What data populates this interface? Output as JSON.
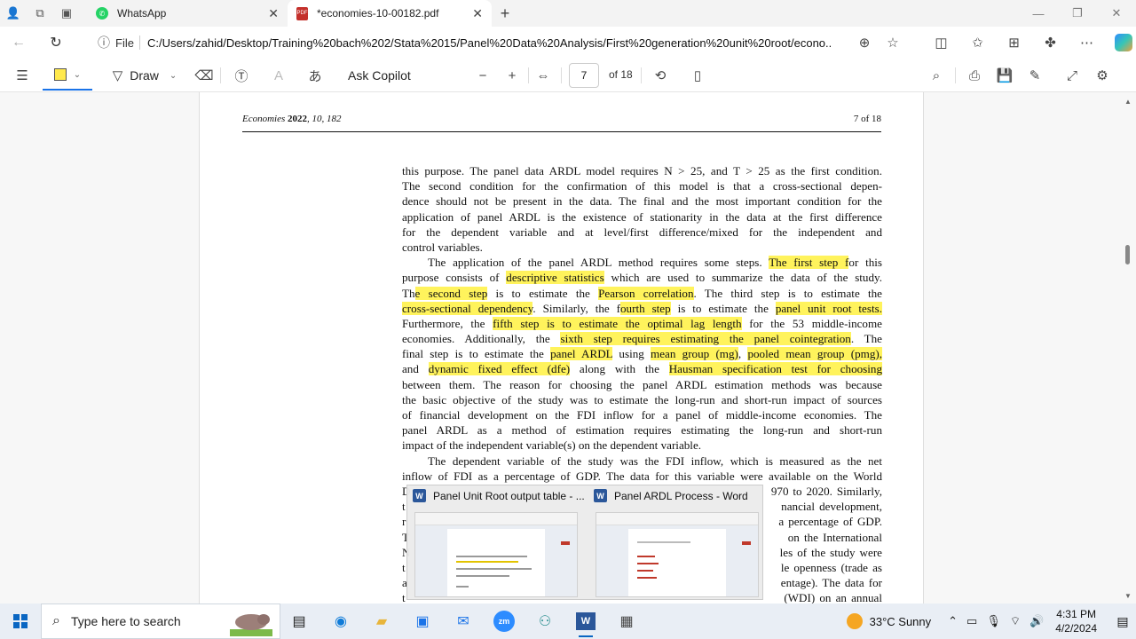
{
  "browser": {
    "tabs": [
      {
        "label": "WhatsApp",
        "close": "✕"
      },
      {
        "label": "*economies-10-00182.pdf",
        "close": "✕"
      }
    ],
    "new_tab": "+",
    "window_controls": [
      "—",
      "❐",
      "✕"
    ],
    "address": {
      "info_label": "File",
      "url": "C:/Users/zahid/Desktop/Training%20bach%202/Stata%2015/Panel%20Data%20Analysis/First%20generation%20unit%20root/econo..."
    }
  },
  "pdf_toolbar": {
    "draw_label": "Draw",
    "copilot_label": "Ask Copilot",
    "page_current": "7",
    "page_total": "of 18"
  },
  "document": {
    "running_head_journal": "Economies",
    "running_head_year": "2022",
    "running_head_vol": ", 10, 182",
    "running_head_page": "7 of 18",
    "lines": [
      {
        "segments": [
          {
            "t": "this purpose. The panel data ARDL model requires N > 25, and T > 25 as the first condition."
          }
        ]
      },
      {
        "segments": [
          {
            "t": "The second condition for the confirmation of this model is that a cross-sectional depen-"
          }
        ]
      },
      {
        "segments": [
          {
            "t": "dence should not be present in the data. The final and the most important condition for the"
          }
        ]
      },
      {
        "segments": [
          {
            "t": "application of panel ARDL is the existence of stationarity in the data at the first difference"
          }
        ]
      },
      {
        "segments": [
          {
            "t": "for the dependent variable and at level/first difference/mixed for the independent and"
          }
        ]
      },
      {
        "last": true,
        "segments": [
          {
            "t": "control variables."
          }
        ]
      },
      {
        "indent": true,
        "segments": [
          {
            "t": "The application of the panel ARDL method requires some steps. "
          },
          {
            "t": "The first step f",
            "hl": true
          },
          {
            "t": "or this"
          }
        ]
      },
      {
        "segments": [
          {
            "t": "purpose consists of "
          },
          {
            "t": "descriptive statistics",
            "hl": true
          },
          {
            "t": " which are used to summarize the data of the study."
          }
        ]
      },
      {
        "segments": [
          {
            "t": "Th"
          },
          {
            "t": "e second step",
            "hl": true
          },
          {
            "t": " is to estimate the "
          },
          {
            "t": "Pearson correlation",
            "hl": true
          },
          {
            "t": ". The third step is to estimate the"
          }
        ]
      },
      {
        "segments": [
          {
            "t": "cross-sectional dependency",
            "hl": true
          },
          {
            "t": ". Similarly, the f"
          },
          {
            "t": "ourth step",
            "hl": true
          },
          {
            "t": " is to estimate the "
          },
          {
            "t": "panel unit root tests.",
            "hl": true
          }
        ]
      },
      {
        "segments": [
          {
            "t": "Furthermore, the "
          },
          {
            "t": "fifth step is to estimate the optimal lag length",
            "hl": true
          },
          {
            "t": " for the 53 middle-income"
          }
        ]
      },
      {
        "segments": [
          {
            "t": "economies. Additionally, the "
          },
          {
            "t": "sixth step requires estimating the panel cointegration",
            "hl": true
          },
          {
            "t": ". The"
          }
        ]
      },
      {
        "segments": [
          {
            "t": "final step is to estimate the "
          },
          {
            "t": "panel ARDL",
            "hl": true
          },
          {
            "t": " using "
          },
          {
            "t": "mean group (mg)",
            "hl": true
          },
          {
            "t": ", "
          },
          {
            "t": "pooled mean group (pmg),",
            "hl": true
          }
        ]
      },
      {
        "segments": [
          {
            "t": "and "
          },
          {
            "t": "dynamic fixed effect (dfe)",
            "hl": true
          },
          {
            "t": " along with the "
          },
          {
            "t": "Hausman specification test for choosing",
            "hl": true
          }
        ]
      },
      {
        "segments": [
          {
            "t": "between them. The reason for choosing the panel ARDL estimation methods was because"
          }
        ]
      },
      {
        "segments": [
          {
            "t": "the basic objective of the study was to estimate the long-run and short-run impact of sources"
          }
        ]
      },
      {
        "segments": [
          {
            "t": "of financial development on the FDI inflow for a panel of middle-income economies. The"
          }
        ]
      },
      {
        "segments": [
          {
            "t": "panel ARDL as a method of estimation requires estimating the long-run and short-run"
          }
        ]
      },
      {
        "last": true,
        "segments": [
          {
            "t": "impact of the independent variable(s) on the dependent variable."
          }
        ]
      },
      {
        "indent": true,
        "segments": [
          {
            "t": "The dependent variable of the study was the FDI inflow, which is measured as the net"
          }
        ]
      },
      {
        "segments": [
          {
            "t": "inflow of FDI as a percentage of GDP. The data for this variable were available on the World"
          }
        ]
      },
      {
        "segments": [
          {
            "t": "D"
          },
          {
            "t": "                                                                                   970 to 2020. Similarly,"
          }
        ]
      },
      {
        "segments": [
          {
            "t": "t"
          },
          {
            "t": "                                                                                   nancial development,"
          }
        ]
      },
      {
        "segments": [
          {
            "t": "r"
          },
          {
            "t": "                                                                                   a percentage of GDP."
          }
        ]
      },
      {
        "segments": [
          {
            "t": "T"
          },
          {
            "t": "                                                                                   on the International"
          }
        ]
      },
      {
        "segments": [
          {
            "t": "N"
          },
          {
            "t": "                                                                                   les of the study were"
          }
        ]
      },
      {
        "segments": [
          {
            "t": "t"
          },
          {
            "t": "                                                                                   le openness (trade as"
          }
        ]
      },
      {
        "segments": [
          {
            "t": "a"
          },
          {
            "t": "                                                                                   entage). The data for"
          }
        ]
      },
      {
        "segments": [
          {
            "t": "t"
          },
          {
            "t": "                                                                                   (WDI) on an annual"
          }
        ]
      }
    ]
  },
  "taskbar_previews": [
    {
      "title": "Panel Unit Root output table - ..."
    },
    {
      "title": "Panel ARDL Process - Word"
    }
  ],
  "taskbar": {
    "search_placeholder": "Type here to search",
    "weather": "33°C  Sunny",
    "time": "4:31 PM",
    "date": "4/2/2024"
  },
  "colors": {
    "highlight": "#fff35c",
    "accent": "#1a73e8"
  }
}
